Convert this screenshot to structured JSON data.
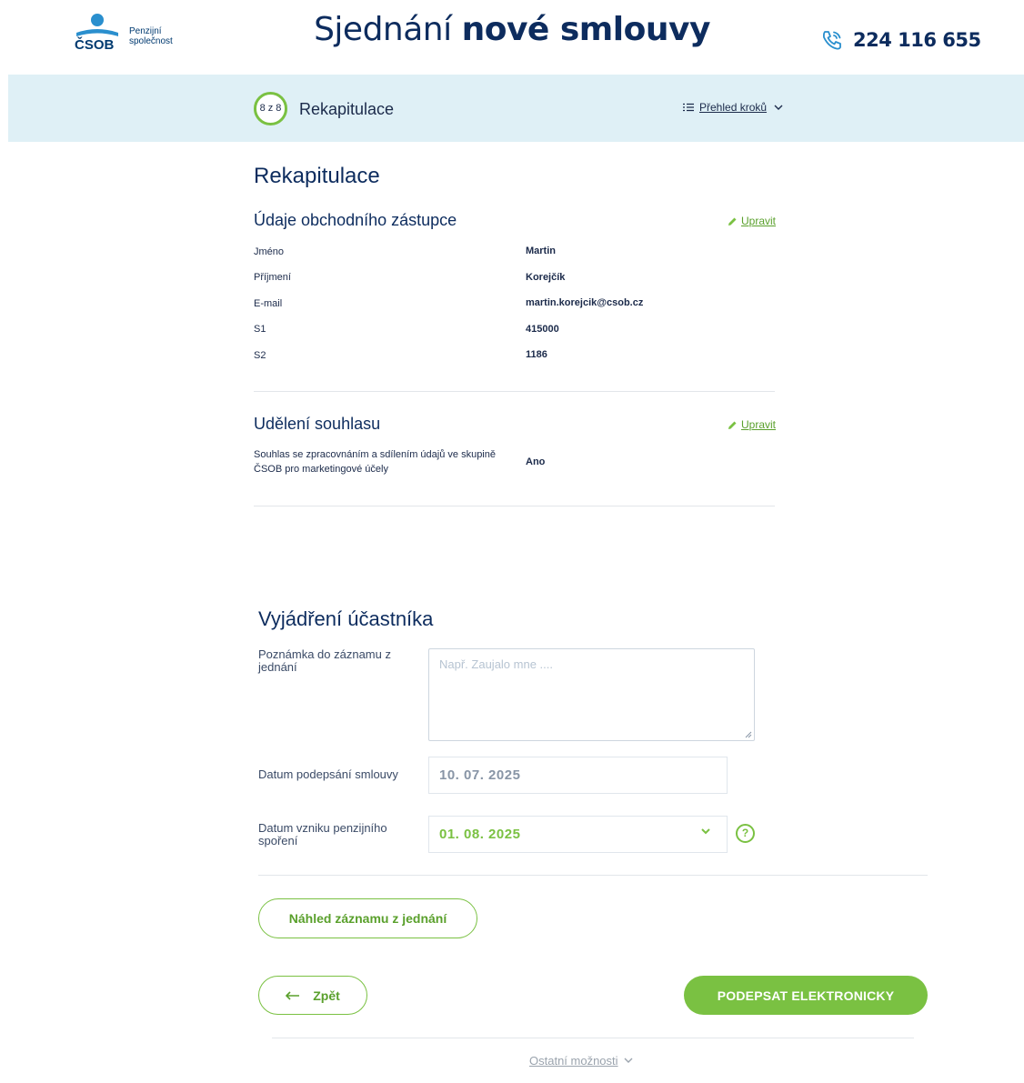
{
  "brand": {
    "logo_word": "ČSOB",
    "logo_sub_line1": "Penzijní",
    "logo_sub_line2": "společnost",
    "accent_color": "#7ac142",
    "navy_color": "#0d2c5e"
  },
  "header": {
    "title_regular": "Sjednání",
    "title_bold": "nové smlouvy",
    "phone": "224 116 655",
    "phone_icon": "phone-icon"
  },
  "stepbar": {
    "step_indicator": "8 z 8",
    "step_title": "Rekapitulace",
    "steps_link_label": "Přehled kroků"
  },
  "recap": {
    "title": "Rekapitulace",
    "agent_section": {
      "title": "Údaje obchodního zástupce",
      "edit_label": "Upravit",
      "rows": [
        {
          "label": "Jméno",
          "value": "Martin"
        },
        {
          "label": "Příjmení",
          "value": "Korejčík"
        },
        {
          "label": "E-mail",
          "value": "martin.korejcik@csob.cz"
        },
        {
          "label": "S1",
          "value": "415000"
        },
        {
          "label": "S2",
          "value": "1186"
        }
      ]
    },
    "consent_section": {
      "title": "Udělení souhlasu",
      "edit_label": "Upravit",
      "rows": [
        {
          "label_line1": "Souhlas se zpracovnáním a sdílením údajů ve skupině",
          "label_line2": "ČSOB pro marketingové účely",
          "value": "Ano"
        }
      ]
    }
  },
  "participant": {
    "title": "Vyjádření účastníka",
    "note_label_line1": "Poznámka do záznamu z",
    "note_label_line2": "jednání",
    "note_placeholder": "Např. Zaujalo mne ....",
    "sign_date_label": "Datum podepsání smlouvy",
    "sign_date_value": "10. 07. 2025",
    "start_date_label_line1": "Datum vzniku penzijního",
    "start_date_label_line2": "spoření",
    "start_date_value": "01. 08. 2025",
    "help_glyph": "?"
  },
  "actions": {
    "preview_label": "Náhled záznamu z jednání",
    "back_label": "Zpět",
    "sign_label": "PODEPSAT ELEKTRONICKY",
    "other_label": "Ostatní možnosti"
  }
}
